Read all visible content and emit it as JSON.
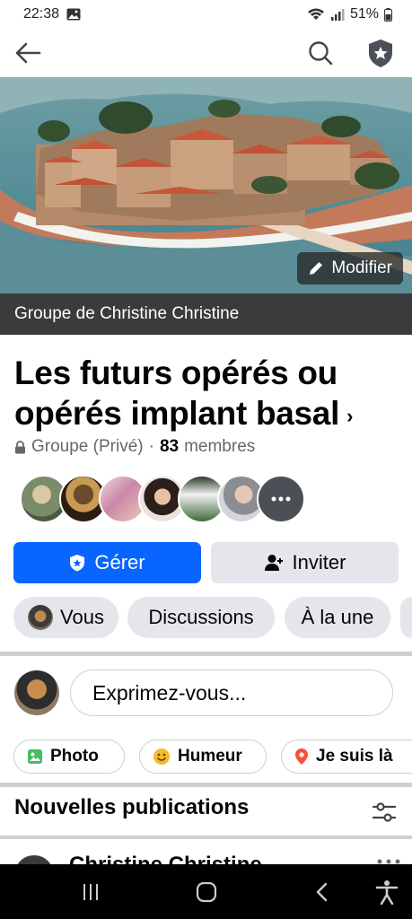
{
  "status_bar": {
    "time": "22:38",
    "battery": "51%"
  },
  "cover": {
    "edit_label": "Modifier"
  },
  "group_bar": {
    "label": "Groupe de Christine Christine"
  },
  "group": {
    "title": "Les futurs opérés ou opérés implant basal",
    "privacy": "Groupe (Privé)",
    "separator": "·",
    "member_count": "83",
    "members_label": "membres"
  },
  "actions": {
    "manage": "Gérer",
    "invite": "Inviter"
  },
  "tabs": [
    {
      "label": "Vous"
    },
    {
      "label": "Discussions"
    },
    {
      "label": "À la une"
    }
  ],
  "composer": {
    "placeholder": "Exprimez-vous..."
  },
  "quick_actions": [
    {
      "label": "Photo"
    },
    {
      "label": "Humeur"
    },
    {
      "label": "Je suis là"
    }
  ],
  "feed": {
    "section_title": "Nouvelles publications",
    "first_author": "Christine Christine"
  },
  "colors": {
    "primary": "#0866ff",
    "chip_bg": "#e4e6eb",
    "group_bar": "#3a3b3c"
  }
}
